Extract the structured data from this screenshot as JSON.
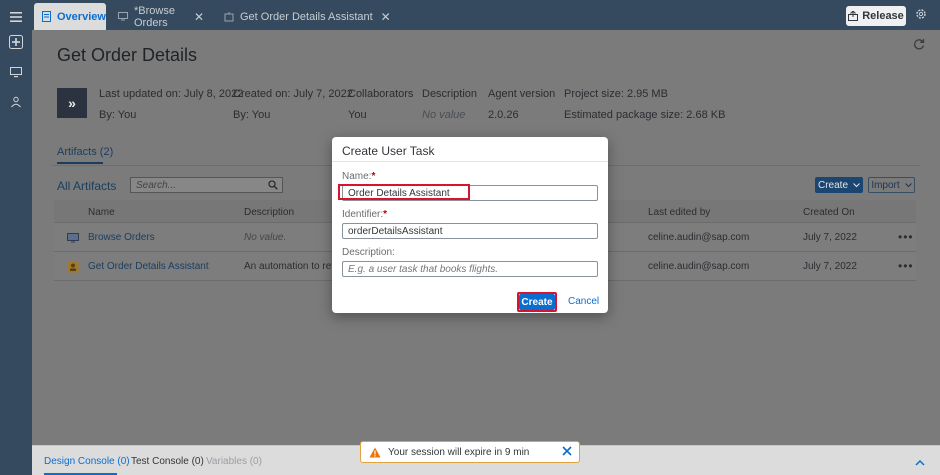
{
  "tabs": [
    {
      "label": "Overview"
    },
    {
      "label": "*Browse Orders"
    },
    {
      "label": "Get Order Details Assistant"
    }
  ],
  "toolbar": {
    "release_label": "Release"
  },
  "page": {
    "title": "Get Order Details",
    "meta": {
      "last_updated": "Last updated on: July 8, 2022",
      "last_updated_by": "By: You",
      "created_on": "Created on: July 7, 2022",
      "created_by": "By: You",
      "collaborators_label": "Collaborators",
      "collaborators_value": "You",
      "description_label": "Description",
      "description_value": "No value",
      "agent_label": "Agent version",
      "agent_value": "2.0.26",
      "project_size": "Project size: 2.95 MB",
      "package_size": "Estimated package size: 2.68 KB"
    },
    "artifacts_tab": "Artifacts (2)",
    "all_artifacts": "All Artifacts",
    "search_placeholder": "Search...",
    "create_label": "Create",
    "import_label": "Import"
  },
  "table": {
    "columns": [
      "Name",
      "Description",
      "Last edited by",
      "Created On"
    ],
    "rows": [
      {
        "name": "Browse Orders",
        "description": "No value.",
        "last_edited": "celine.audin@sap.com",
        "created": "July 7, 2022"
      },
      {
        "name": "Get Order Details Assistant",
        "description": "An automation to retriev",
        "last_edited": "celine.audin@sap.com",
        "created": "July 7, 2022"
      }
    ]
  },
  "dialog": {
    "title": "Create User Task",
    "name_label": "Name:",
    "name_value": "Order Details Assistant",
    "identifier_label": "Identifier:",
    "identifier_value": "orderDetailsAssistant",
    "description_label": "Description:",
    "description_placeholder": "E.g. a user task that books flights.",
    "create_label": "Create",
    "cancel_label": "Cancel"
  },
  "bottom": {
    "tabs": [
      "Design Console (0)",
      "Test Console (0)",
      "Variables (0)"
    ]
  },
  "toast": {
    "message": "Your session will expire in 9 min"
  },
  "colors": {
    "accent": "#0a6ed1",
    "shell": "#354a5f",
    "highlight": "#d7132f",
    "warning": "#e9730c"
  }
}
